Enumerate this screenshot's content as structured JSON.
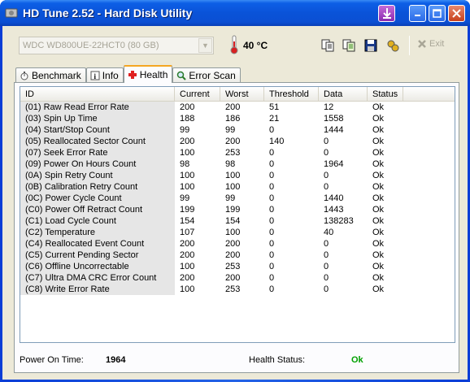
{
  "window": {
    "title": "HD Tune 2.52 - Hard Disk Utility"
  },
  "toolbar": {
    "drive": "WDC WD800UE-22HCT0 (80 GB)",
    "temperature": "40 °C",
    "exit_label": "Exit"
  },
  "tabs": [
    {
      "label": "Benchmark",
      "icon": "stopwatch-icon"
    },
    {
      "label": "Info",
      "icon": "info-icon"
    },
    {
      "label": "Health",
      "icon": "health-cross-icon",
      "active": true
    },
    {
      "label": "Error Scan",
      "icon": "magnifier-icon"
    }
  ],
  "table": {
    "headers": [
      "ID",
      "Current",
      "Worst",
      "Threshold",
      "Data",
      "Status"
    ],
    "rows": [
      [
        "(01) Raw Read Error Rate",
        "200",
        "200",
        "51",
        "12",
        "Ok"
      ],
      [
        "(03) Spin Up Time",
        "188",
        "186",
        "21",
        "1558",
        "Ok"
      ],
      [
        "(04) Start/Stop Count",
        "99",
        "99",
        "0",
        "1444",
        "Ok"
      ],
      [
        "(05) Reallocated Sector Count",
        "200",
        "200",
        "140",
        "0",
        "Ok"
      ],
      [
        "(07) Seek Error Rate",
        "100",
        "253",
        "0",
        "0",
        "Ok"
      ],
      [
        "(09) Power On Hours Count",
        "98",
        "98",
        "0",
        "1964",
        "Ok"
      ],
      [
        "(0A) Spin Retry Count",
        "100",
        "100",
        "0",
        "0",
        "Ok"
      ],
      [
        "(0B) Calibration Retry Count",
        "100",
        "100",
        "0",
        "0",
        "Ok"
      ],
      [
        "(0C) Power Cycle Count",
        "99",
        "99",
        "0",
        "1440",
        "Ok"
      ],
      [
        "(C0) Power Off Retract Count",
        "199",
        "199",
        "0",
        "1443",
        "Ok"
      ],
      [
        "(C1) Load Cycle Count",
        "154",
        "154",
        "0",
        "138283",
        "Ok"
      ],
      [
        "(C2) Temperature",
        "107",
        "100",
        "0",
        "40",
        "Ok"
      ],
      [
        "(C4) Reallocated Event Count",
        "200",
        "200",
        "0",
        "0",
        "Ok"
      ],
      [
        "(C5) Current Pending Sector",
        "200",
        "200",
        "0",
        "0",
        "Ok"
      ],
      [
        "(C6) Offline Uncorrectable",
        "100",
        "253",
        "0",
        "0",
        "Ok"
      ],
      [
        "(C7) Ultra DMA CRC Error Count",
        "200",
        "200",
        "0",
        "0",
        "Ok"
      ],
      [
        "(C8) Write Error Rate",
        "100",
        "253",
        "0",
        "0",
        "Ok"
      ]
    ]
  },
  "footer": {
    "power_on_label": "Power On Time:",
    "power_on_value": "1964",
    "health_label": "Health Status:",
    "health_value": "Ok"
  },
  "colors": {
    "ok_green": "#00a000",
    "title_blue": "#0a53d8",
    "active_tab_accent": "#f5a623"
  }
}
